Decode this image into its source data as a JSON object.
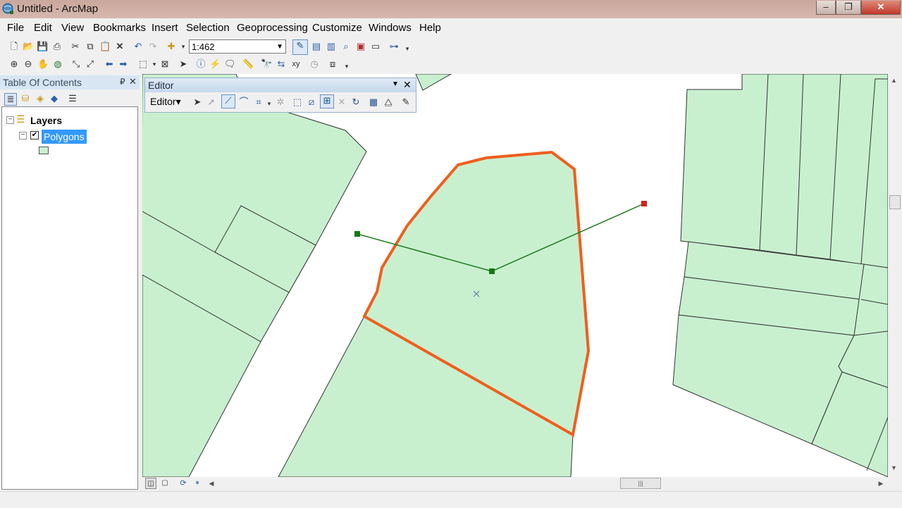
{
  "window": {
    "title": "Untitled - ArcMap",
    "minimize": "–",
    "maximize": "❐",
    "close": "✕"
  },
  "menu": [
    "File",
    "Edit",
    "View",
    "Bookmarks",
    "Insert",
    "Selection",
    "Geoprocessing",
    "Customize",
    "Windows",
    "Help"
  ],
  "toolbar": {
    "scale_value": "1:462"
  },
  "toc": {
    "title": "Table Of Contents",
    "pin": "₽",
    "close": "✕",
    "layers_group": "Layers",
    "layer_name": "Polygons",
    "layer_checked": true,
    "symbol_color": "#c8f0cf"
  },
  "editor": {
    "title": "Editor",
    "menu_label": "Editor▾",
    "close": "✕"
  },
  "colors": {
    "polygon_fill": "#c8f0cf",
    "polygon_stroke": "#333333",
    "selected_stroke": "#ef5f1e",
    "sketch_line": "#1c7a1c",
    "sketch_vertex": "#137a13",
    "sketch_last_vertex": "#d81e1e",
    "selection_highlight": "#3399ff"
  }
}
